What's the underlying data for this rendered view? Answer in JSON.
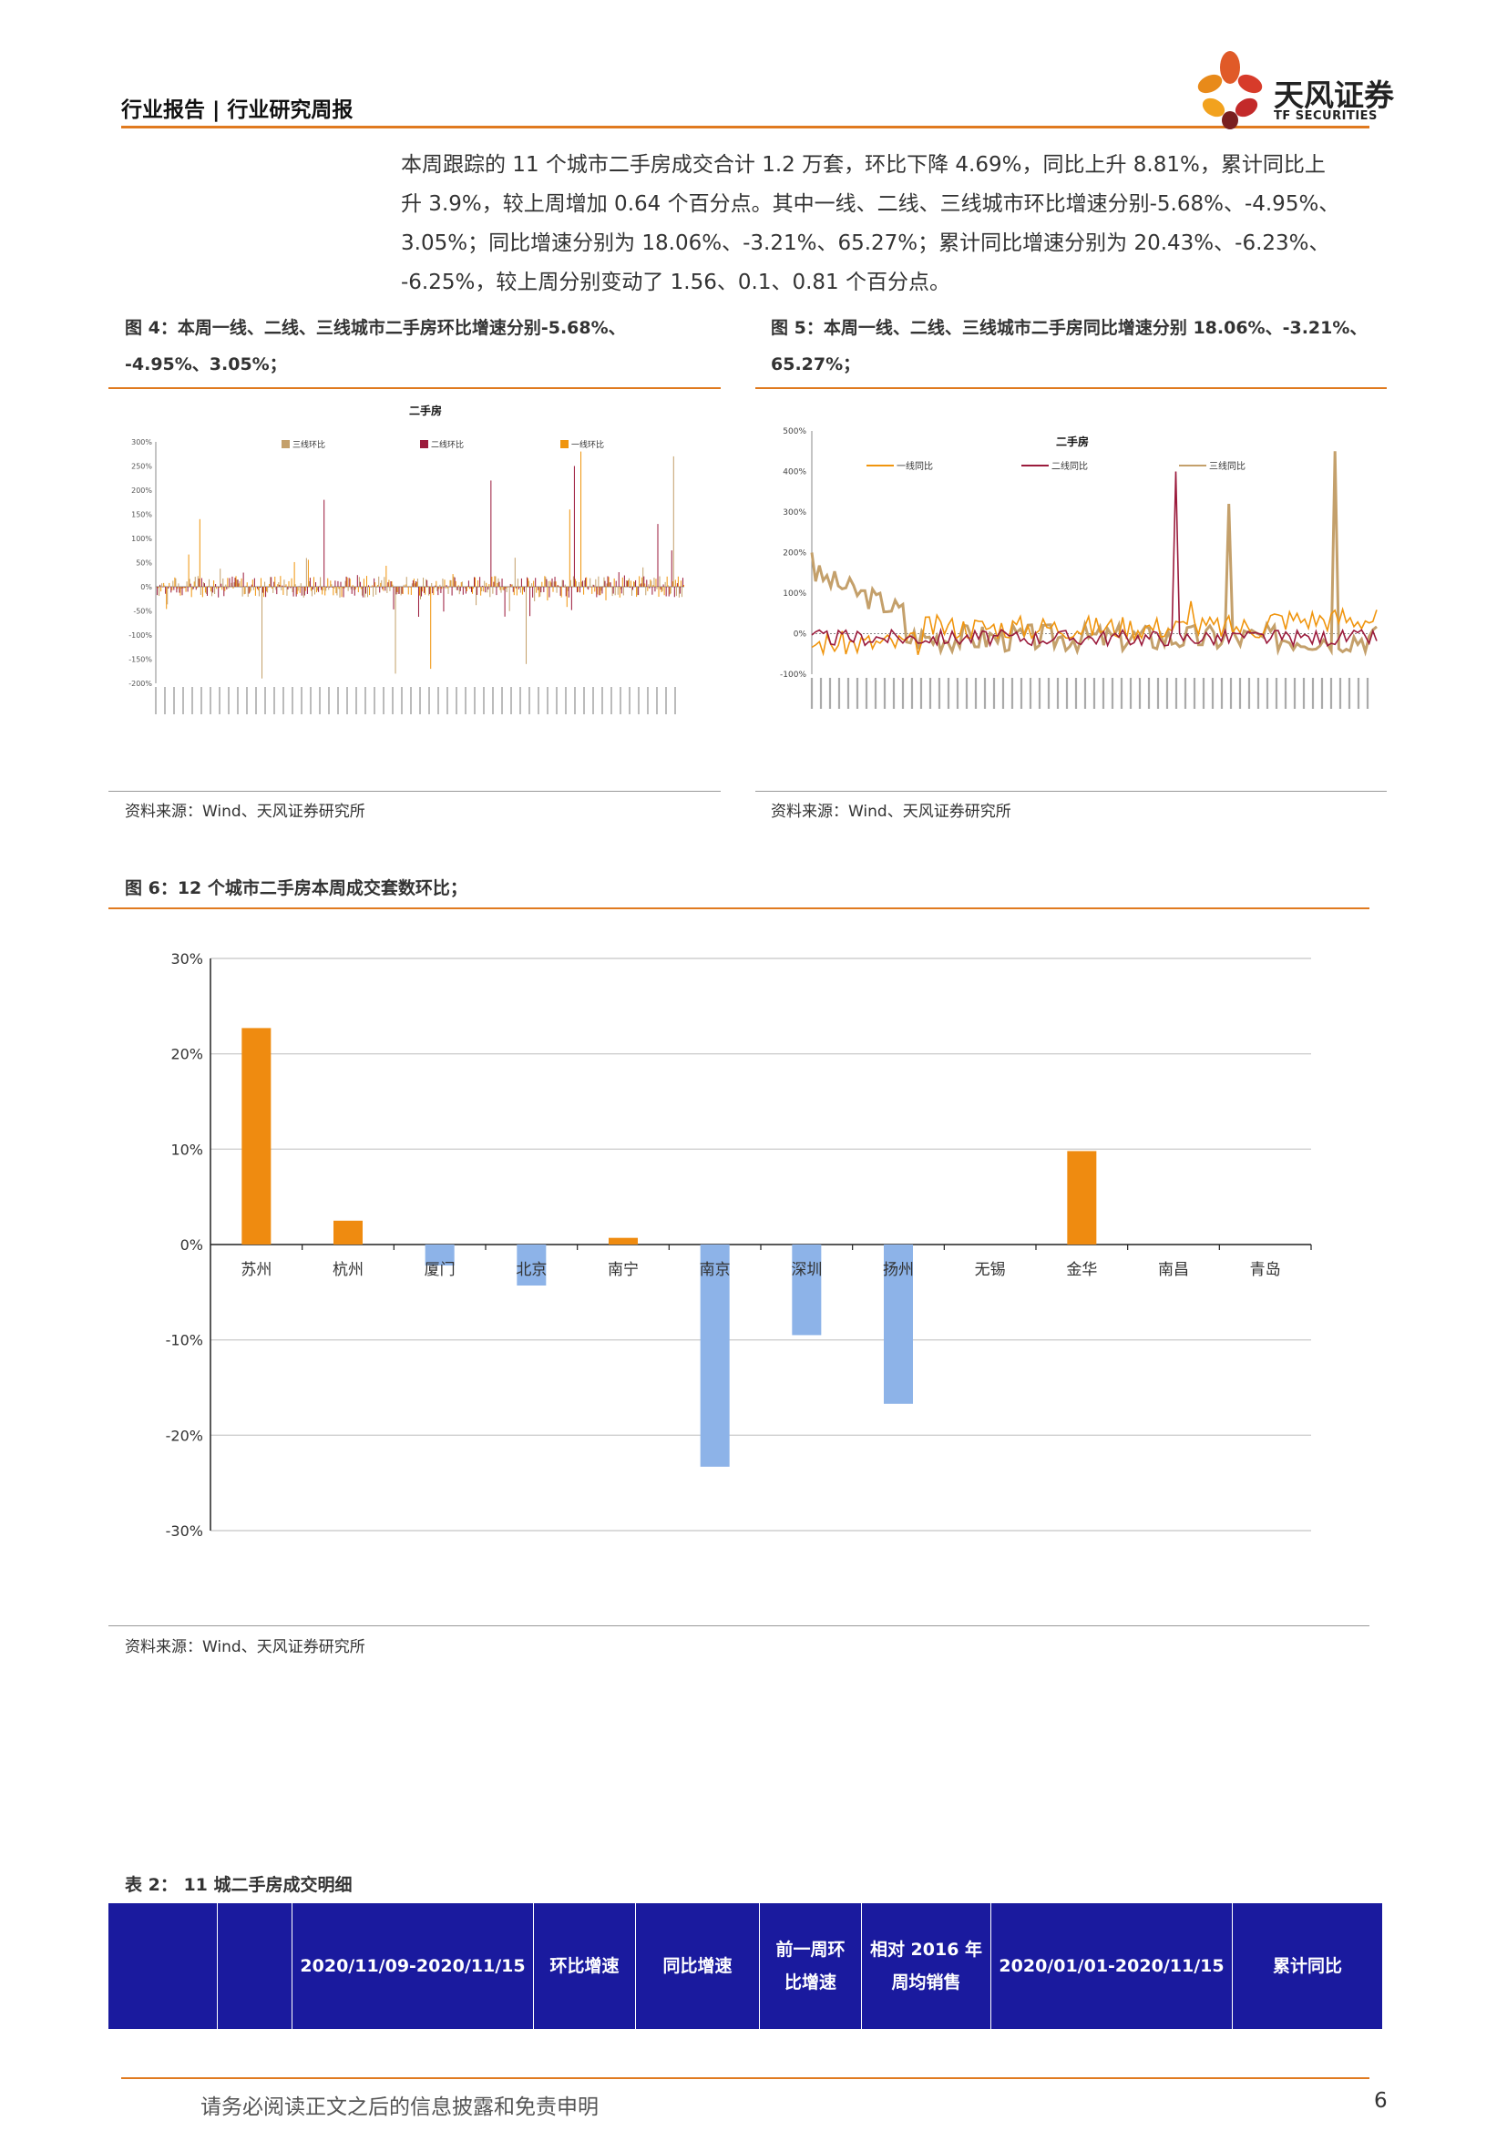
{
  "header": {
    "title": "行业报告 | 行业研究周报",
    "logo_cn": "天风证券",
    "logo_en": "TF SECURITIES"
  },
  "paragraph": [
    "本周跟踪的 11 个城市二手房成交合计 1.2 万套，环比下降 4.69%，同比上升 8.81%，累计同比上",
    "升 3.9%，较上周增加 0.64 个百分点。其中一线、二线、三线城市环比增速分别-5.68%、-4.95%、",
    "3.05%；同比增速分别为 18.06%、-3.21%、65.27%；累计同比增速分别为 20.43%、-6.23%、",
    "-6.25%，较上周分别变动了 1.56、0.1、0.81 个百分点。"
  ],
  "fig4": {
    "title_line1": "图 4：本周一线、二线、三线城市二手房环比增速分别-5.68%、",
    "title_line2": "-4.95%、3.05%；",
    "chart_title": "二手房",
    "legend": [
      "三线环比",
      "二线环比",
      "一线环比"
    ],
    "y_ticks": [
      "300%",
      "250%",
      "200%",
      "150%",
      "100%",
      "50%",
      "0%",
      "-50%",
      "-100%",
      "-150%",
      "-200%"
    ],
    "source": "资料来源：Wind、天风证券研究所"
  },
  "fig5": {
    "title_line1": "图 5：本周一线、二线、三线城市二手房同比增速分别 18.06%、-3.21%、",
    "title_line2": "65.27%；",
    "chart_title": "二手房",
    "legend": [
      "一线同比",
      "二线同比",
      "三线同比"
    ],
    "y_ticks": [
      "500%",
      "400%",
      "300%",
      "200%",
      "100%",
      "0%",
      "-100%"
    ],
    "source": "资料来源：Wind、天风证券研究所"
  },
  "fig6": {
    "title": "图 6：12 个城市二手房本周成交套数环比；",
    "source": "资料来源：Wind、天风证券研究所"
  },
  "chart_data": [
    {
      "type": "bar",
      "title": "二手房",
      "series": [
        {
          "name": "三线环比",
          "color": "#c4a06b"
        },
        {
          "name": "二线环比",
          "color": "#9b1b3c"
        },
        {
          "name": "一线环比",
          "color": "#f0950e"
        }
      ],
      "ylim": [
        -200,
        300
      ],
      "yunit": "%"
    },
    {
      "type": "line",
      "title": "二手房",
      "series": [
        {
          "name": "一线同比",
          "color": "#f0950e"
        },
        {
          "name": "二线同比",
          "color": "#9b1b3c"
        },
        {
          "name": "三线同比",
          "color": "#c4a06b"
        }
      ],
      "ylim": [
        -100,
        500
      ],
      "yunit": "%"
    },
    {
      "type": "bar",
      "categories": [
        "苏州",
        "杭州",
        "厦门",
        "北京",
        "南宁",
        "南京",
        "深圳",
        "扬州",
        "无锡",
        "金华",
        "南昌",
        "青岛"
      ],
      "values": [
        22.7,
        2.5,
        -2.2,
        -4.3,
        0.7,
        -23.3,
        -9.5,
        -16.7,
        0,
        9.8,
        0,
        0
      ],
      "ylim": [
        -30,
        30
      ],
      "y_ticks": [
        "30%",
        "20%",
        "10%",
        "0%",
        "-10%",
        "-20%",
        "-30%"
      ],
      "positive_color": "#ef8b10",
      "negative_color": "#8db3e8",
      "grid": true
    }
  ],
  "table2": {
    "title": "表 2：  11 城二手房成交明细",
    "headers": [
      "",
      "",
      "2020/11/09-2020/11/15",
      "环比增速",
      "同比增速",
      "前一周环\n比增速",
      "相对 2016 年\n周均销售",
      "2020/01/01-2020/11/15",
      "累计同比"
    ]
  },
  "footer": {
    "disclaimer": "请务必阅读正文之后的信息披露和免责申明",
    "page": "6"
  }
}
